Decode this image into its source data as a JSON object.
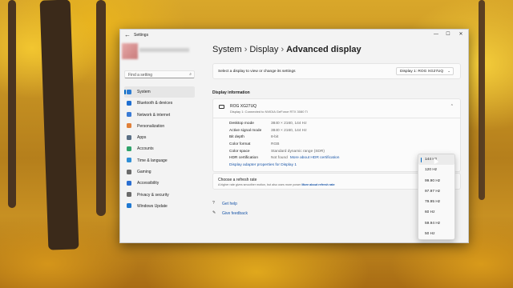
{
  "window": {
    "app_title": "Settings",
    "back_icon": "back-arrow-icon",
    "controls": {
      "minimize": "—",
      "maximize": "☐",
      "close": "✕"
    }
  },
  "search": {
    "placeholder": "Find a setting",
    "icon": "search-icon"
  },
  "sidebar": {
    "items": [
      {
        "label": "System",
        "icon": "monitor-icon",
        "color": "#2b7cd3",
        "active": true
      },
      {
        "label": "Bluetooth & devices",
        "icon": "bluetooth-icon",
        "color": "#1f6fd1"
      },
      {
        "label": "Network & internet",
        "icon": "wifi-icon",
        "color": "#3a7bd5"
      },
      {
        "label": "Personalization",
        "icon": "brush-icon",
        "color": "#e0803a"
      },
      {
        "label": "Apps",
        "icon": "apps-icon",
        "color": "#5a6f85"
      },
      {
        "label": "Accounts",
        "icon": "person-icon",
        "color": "#2fa36b"
      },
      {
        "label": "Time & language",
        "icon": "globe-clock-icon",
        "color": "#2f8fd6"
      },
      {
        "label": "Gaming",
        "icon": "gamepad-icon",
        "color": "#6b6b6b"
      },
      {
        "label": "Accessibility",
        "icon": "accessibility-icon",
        "color": "#2b6fd1"
      },
      {
        "label": "Privacy & security",
        "icon": "shield-icon",
        "color": "#6a6a6a"
      },
      {
        "label": "Windows Update",
        "icon": "update-icon",
        "color": "#1f78d1"
      }
    ]
  },
  "breadcrumb": {
    "part1": "System",
    "part2": "Display",
    "current": "Advanced display",
    "sep": "›"
  },
  "display_select": {
    "label": "Select a display to view or change its settings",
    "value": "Display 1: ROG XG27UQ"
  },
  "display_info": {
    "section_title": "Display information",
    "monitor_name": "ROG XG27UQ",
    "monitor_sub": "Display 1: Connected to NVIDIA GeForce RTX 3080 Ti",
    "rows": [
      {
        "label": "Desktop mode",
        "value": "3840 × 2160, 144 Hz"
      },
      {
        "label": "Active signal mode",
        "value": "3840 × 2160, 144 Hz"
      },
      {
        "label": "Bit depth",
        "value": "8-bit"
      },
      {
        "label": "Color format",
        "value": "RGB"
      },
      {
        "label": "Color space",
        "value": "Standard dynamic range (SDR)"
      },
      {
        "label": "HDR certification",
        "value": "Not found",
        "link": "More about HDR certification"
      }
    ],
    "adapter_link": "Display adapter properties for Display 1"
  },
  "refresh_rate": {
    "title": "Choose a refresh rate",
    "desc": "A higher rate gives smoother motion, but also uses more power",
    "link": "More about refresh rate",
    "options": [
      "144 Hz",
      "120 Hz",
      "99.90 Hz",
      "97.97 Hz",
      "79.95 Hz",
      "60 Hz",
      "59.94 Hz",
      "50 Hz"
    ],
    "selected": "144 Hz"
  },
  "help": {
    "get_help": "Get help",
    "feedback": "Give feedback"
  }
}
